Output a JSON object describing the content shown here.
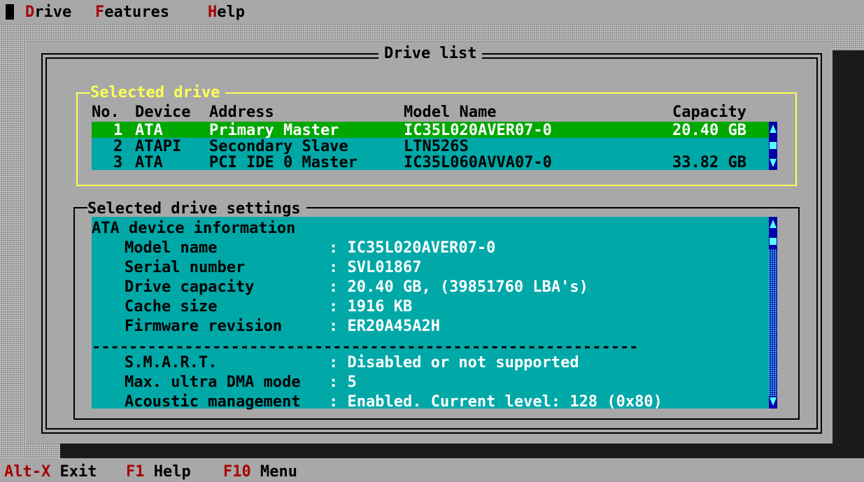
{
  "menu": {
    "items": [
      {
        "hotkey": "D",
        "rest": "rive"
      },
      {
        "hotkey": "F",
        "rest": "eatures"
      },
      {
        "hotkey": "H",
        "rest": "elp"
      }
    ]
  },
  "window": {
    "title": "Drive list"
  },
  "selected_drive": {
    "title": "Selected drive",
    "columns": [
      "No.",
      "Device",
      "Address",
      "Model Name",
      "Capacity"
    ],
    "rows": [
      {
        "no": "1",
        "device": "ATA",
        "address": "Primary Master",
        "model": "IC35L020AVER07-0",
        "capacity": "20.40 GB",
        "selected": true
      },
      {
        "no": "2",
        "device": "ATAPI",
        "address": "Secondary Slave",
        "model": "LTN526S",
        "capacity": "",
        "selected": false
      },
      {
        "no": "3",
        "device": "ATA",
        "address": "PCI IDE 0 Master",
        "model": "IC35L060AVVA07-0",
        "capacity": "33.82 GB",
        "selected": false
      }
    ]
  },
  "settings": {
    "title": "Selected drive settings",
    "section_heading": "ATA device information",
    "fields": [
      {
        "label": "Model name",
        "value": ": IC35L020AVER07-0"
      },
      {
        "label": "Serial number",
        "value": ": SVL01867"
      },
      {
        "label": "Drive capacity",
        "value": ": 20.40 GB, (39851760 LBA's)"
      },
      {
        "label": "Cache size",
        "value": ": 1916 KB"
      },
      {
        "label": "Firmware revision",
        "value": ": ER20A45A2H"
      }
    ],
    "divider": "-----------------------------------------------------------",
    "fields2": [
      {
        "label": "S.M.A.R.T.",
        "value": ": Disabled or not supported"
      },
      {
        "label": "Max. ultra DMA mode",
        "value": ": 5"
      },
      {
        "label": "Acoustic management",
        "value": ": Enabled. Current level: 128 (0x80)"
      }
    ]
  },
  "statusbar": {
    "keys": [
      {
        "key": "Alt-X",
        "label": "Exit"
      },
      {
        "key": "F1",
        "label": "Help"
      },
      {
        "key": "F10",
        "label": "Menu"
      }
    ]
  },
  "colors": {
    "background": "#a8a8a8",
    "highlight": "#00a800",
    "list": "#00a8a8",
    "hotkey": "#a80000",
    "frame": "#ffff55",
    "scrollbar": "#0000a8"
  },
  "icons": [
    "scroll-up-arrow-icon",
    "scroll-down-arrow-icon",
    "scroll-thumb-icon"
  ]
}
